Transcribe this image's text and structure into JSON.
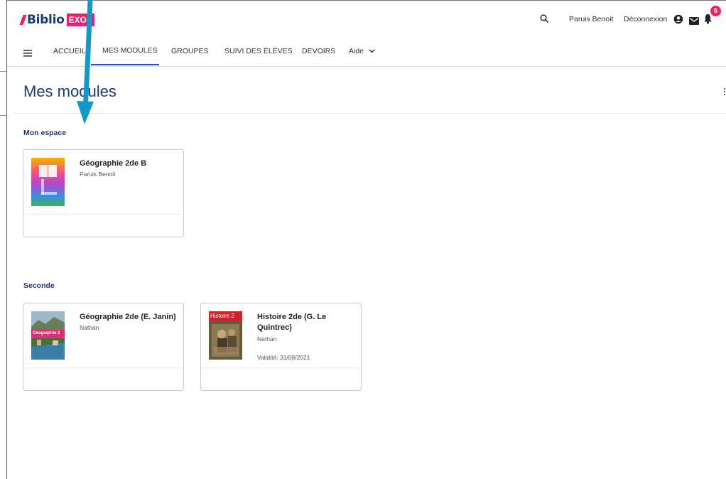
{
  "header": {
    "logo_text": "Biblio",
    "logo_badge": "EXOS",
    "user_name": "Paruis Benoit",
    "logout_label": "Déconnexion",
    "notification_count": "5"
  },
  "nav": {
    "items": [
      {
        "label": "ACCUEIL"
      },
      {
        "label": "MES MODULES"
      },
      {
        "label": "GROUPES"
      },
      {
        "label": "SUIVI DES ÉLÈVES"
      },
      {
        "label": "DEVOIRS"
      },
      {
        "label": "Aide"
      }
    ]
  },
  "page": {
    "title": "Mes modules"
  },
  "sections": [
    {
      "title": "Mon espace",
      "cards": [
        {
          "title": "Géographie 2de B",
          "subtitle": "Paruis Benoit"
        }
      ]
    },
    {
      "title": "Seconde",
      "cards": [
        {
          "title": "Géographie 2de (E. Janin)",
          "subtitle": "Nathan",
          "cover_text": "Géographie 2"
        },
        {
          "title": "Histoire 2de (G. Le Quintrec)",
          "subtitle": "Nathan",
          "validity": "Validité: 31/08/2021",
          "cover_text": "Histoire 2"
        }
      ]
    }
  ],
  "colors": {
    "brand_navy": "#1e3a72",
    "brand_pink": "#e8216b",
    "annotation_arrow": "#1597c9"
  }
}
